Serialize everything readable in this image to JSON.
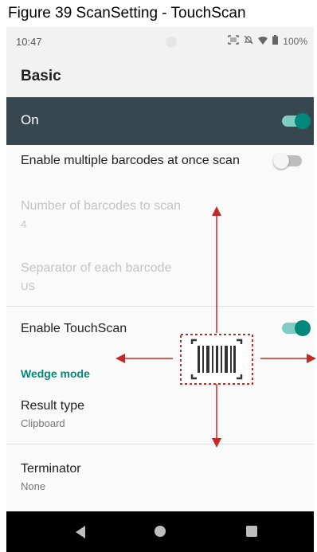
{
  "caption": "Figure 39 ScanSetting - TouchScan",
  "status": {
    "time": "10:47",
    "battery": "100%"
  },
  "appbar": {
    "title": "Basic"
  },
  "master": {
    "label": "On",
    "on": true
  },
  "settings": [
    {
      "title": "Enable multiple barcodes at once scan",
      "toggle": false
    },
    {
      "title": "Number of barcodes to scan",
      "value": "4",
      "disabled": true
    },
    {
      "title": "Separator of each barcode",
      "value": "US",
      "disabled": true
    },
    {
      "title": "Enable TouchScan",
      "toggle": true
    }
  ],
  "section": {
    "label": "Wedge mode"
  },
  "result_type": {
    "title": "Result type",
    "value": "Clipboard"
  },
  "terminator": {
    "title": "Terminator",
    "value": "None"
  },
  "colors": {
    "accent": "#00897b",
    "arrow": "#c62828",
    "master_bg": "#37474f"
  },
  "icons": [
    "barcode-icon",
    "back-icon",
    "home-icon",
    "recents-icon"
  ]
}
